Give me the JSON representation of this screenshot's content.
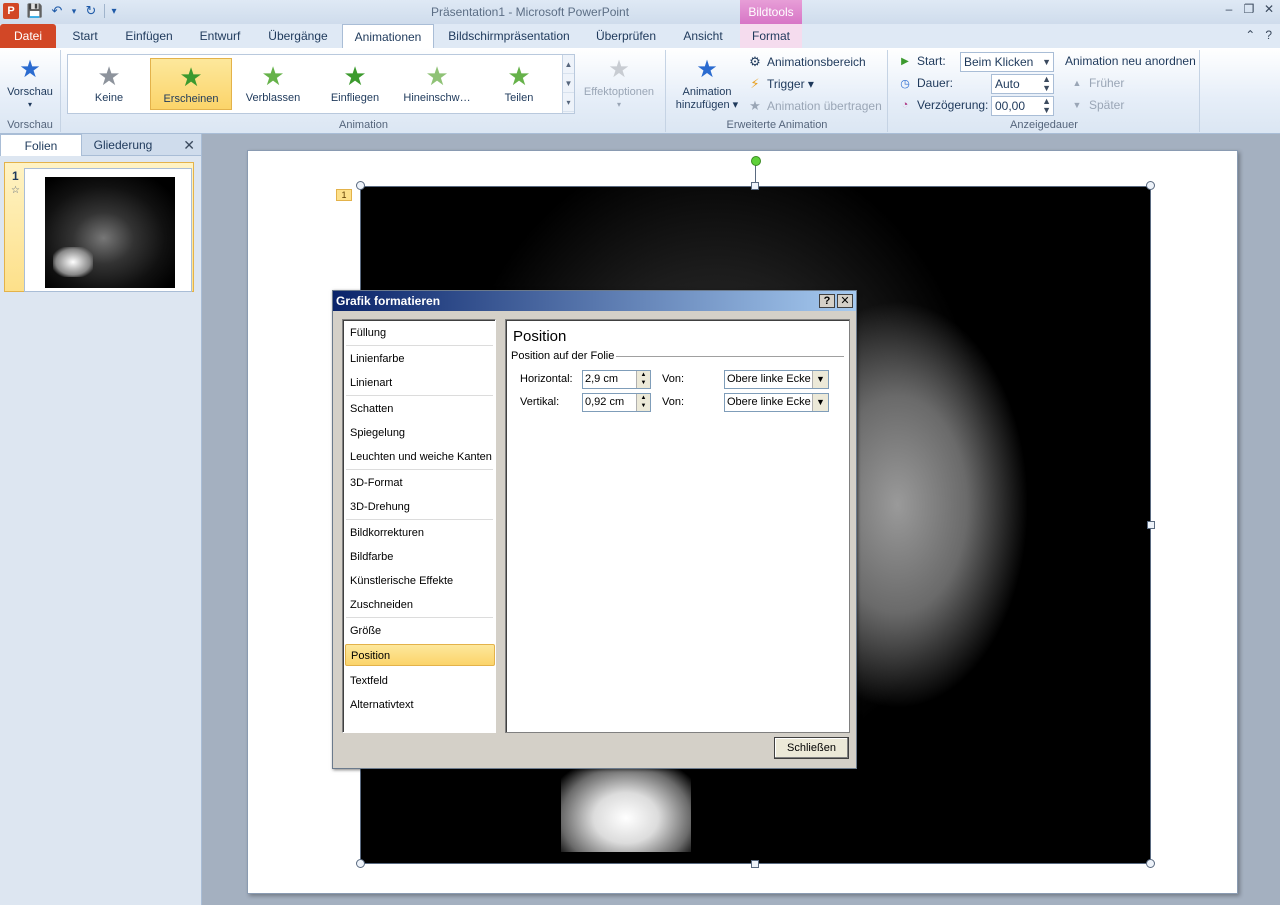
{
  "window": {
    "app_icon": "P",
    "title": "Präsentation1  -  Microsoft PowerPoint",
    "context_tab_header": "Bildtools",
    "controls": [
      "–",
      "❐",
      "✕"
    ]
  },
  "qat": {
    "save": "💾",
    "undo": "↶",
    "undo_drop": "▾",
    "redo": "↻",
    "customize": "▾"
  },
  "tabs": {
    "file": "Datei",
    "items": [
      "Start",
      "Einfügen",
      "Entwurf",
      "Übergänge",
      "Animationen",
      "Bildschirmpräsentation",
      "Überprüfen",
      "Ansicht"
    ],
    "format": "Format",
    "help_icons": [
      "⌃",
      "?"
    ]
  },
  "ribbon": {
    "vorschau": {
      "button": "Vorschau",
      "drop": "▾",
      "group_label": "Vorschau"
    },
    "animation": {
      "gallery": [
        "Keine",
        "Erscheinen",
        "Verblassen",
        "Einfliegen",
        "Hineinschw…",
        "Teilen"
      ],
      "selected": "Erscheinen",
      "effect_options": "Effektoptionen",
      "effect_drop": "▾",
      "group_label": "Animation"
    },
    "advanced": {
      "add_animation_line1": "Animation",
      "add_animation_line2": "hinzufügen ▾",
      "animation_pane": "Animationsbereich",
      "trigger": "Trigger ▾",
      "copy_animation": "Animation übertragen",
      "group_label": "Erweiterte Animation"
    },
    "timing": {
      "start_label": "Start:",
      "start_value": "Beim Klicken",
      "duration_label": "Dauer:",
      "duration_value": "Auto",
      "delay_label": "Verzögerung:",
      "delay_value": "00,00",
      "reorder_title": "Animation neu anordnen",
      "earlier": "Früher",
      "later": "Später",
      "group_label": "Anzeigedauer"
    }
  },
  "leftpane": {
    "tab_slides": "Folien",
    "tab_outline": "Gliederung",
    "close": "✕",
    "slide_number": "1",
    "anim_indicator": "☆"
  },
  "slide": {
    "anim_tag": "1"
  },
  "dialog": {
    "title": "Grafik formatieren",
    "help": "?",
    "close": "✕",
    "nav": [
      "Füllung",
      "Linienfarbe",
      "Linienart",
      "Schatten",
      "Spiegelung",
      "Leuchten und weiche Kanten",
      "3D-Format",
      "3D-Drehung",
      "Bildkorrekturen",
      "Bildfarbe",
      "Künstlerische Effekte",
      "Zuschneiden",
      "Größe",
      "Position",
      "Textfeld",
      "Alternativtext"
    ],
    "selected": "Position",
    "heading": "Position",
    "section": "Position auf der Folie",
    "horizontal_label": "Horizontal:",
    "horizontal_value": "2,9 cm",
    "vertical_label": "Vertikal:",
    "vertical_value": "0,92 cm",
    "from_label": "Von:",
    "from_value_h": "Obere linke Ecke",
    "from_value_v": "Obere linke Ecke",
    "close_button": "Schließen"
  }
}
